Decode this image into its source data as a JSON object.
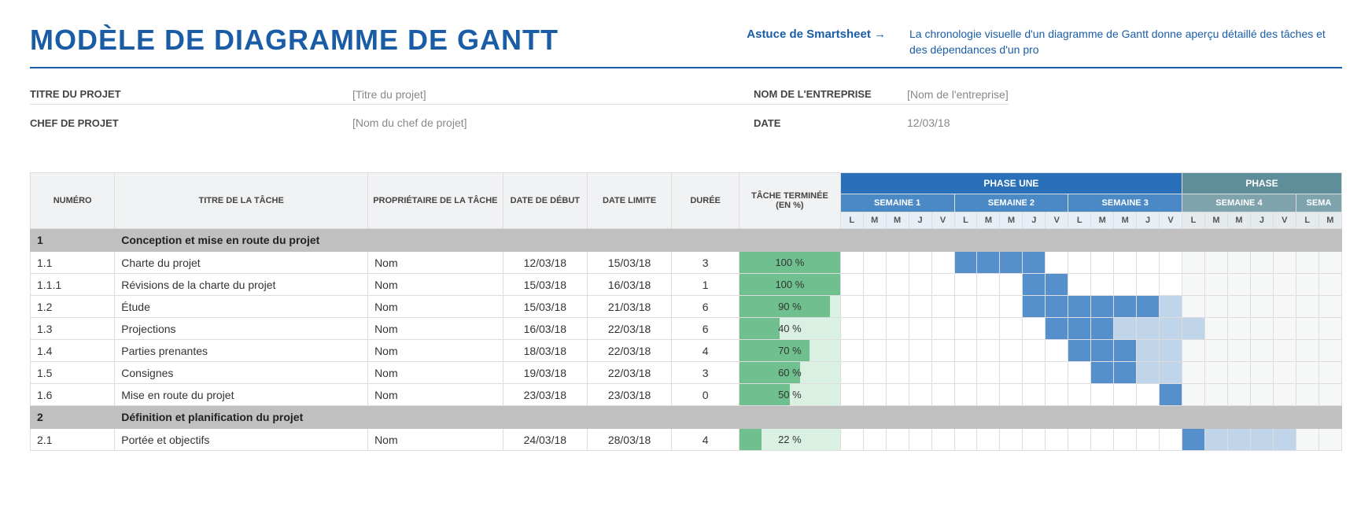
{
  "header": {
    "title": "MODÈLE DE DIAGRAMME DE GANTT",
    "tip_label": "Astuce de Smartsheet →",
    "tip_text": "La chronologie visuelle d'un diagramme de Gantt donne aperçu détaillé des tâches et des dépendances d'un pro"
  },
  "meta": {
    "project_title_label": "TITRE DU PROJET",
    "project_title_value": "[Titre du projet]",
    "project_manager_label": "CHEF DE PROJET",
    "project_manager_value": "[Nom du chef de projet]",
    "company_label": "NOM DE L'ENTREPRISE",
    "company_value": "[Nom de l'entreprise]",
    "date_label": "DATE",
    "date_value": "12/03/18"
  },
  "columns": {
    "num": "NUMÉRO",
    "title": "TITRE DE LA TÂCHE",
    "owner": "PROPRIÉTAIRE DE LA TÂCHE",
    "start": "DATE DE DÉBUT",
    "end": "DATE LIMITE",
    "duration": "DURÉE",
    "pct": "TÂCHE TERMINÉE (EN %)"
  },
  "phases": [
    {
      "label": "PHASE UNE",
      "weeks": [
        "SEMAINE 1",
        "SEMAINE 2",
        "SEMAINE 3"
      ]
    },
    {
      "label": "PHASE",
      "weeks": [
        "SEMAINE 4",
        "SEMA"
      ]
    }
  ],
  "days": [
    "L",
    "M",
    "M",
    "J",
    "V"
  ],
  "partial_days": [
    "L",
    "M"
  ],
  "rows": [
    {
      "type": "section",
      "num": "1",
      "title": "Conception et mise en route du projet"
    },
    {
      "type": "task",
      "num": "1.1",
      "title": "Charte du projet",
      "owner": "Nom",
      "start": "12/03/18",
      "end": "15/03/18",
      "duration": "3",
      "pct_label": "100 %",
      "pct": 100,
      "bar_start": 0,
      "bar_len": 0,
      "bar_dark_start": 5,
      "bar_dark_len": 4
    },
    {
      "type": "task",
      "num": "1.1.1",
      "title": "Révisions de la charte du projet",
      "owner": "Nom",
      "start": "15/03/18",
      "end": "16/03/18",
      "duration": "1",
      "pct_label": "100 %",
      "pct": 100,
      "bar_start": 0,
      "bar_len": 0,
      "bar_dark_start": 8,
      "bar_dark_len": 2
    },
    {
      "type": "task",
      "num": "1.2",
      "title": "Étude",
      "owner": "Nom",
      "start": "15/03/18",
      "end": "21/03/18",
      "duration": "6",
      "pct_label": "90 %",
      "pct": 90,
      "bar_start": 14,
      "bar_len": 1,
      "bar_dark_start": 8,
      "bar_dark_len": 6
    },
    {
      "type": "task",
      "num": "1.3",
      "title": "Projections",
      "owner": "Nom",
      "start": "16/03/18",
      "end": "22/03/18",
      "duration": "6",
      "pct_label": "40 %",
      "pct": 40,
      "bar_start": 12,
      "bar_len": 4,
      "bar_dark_start": 9,
      "bar_dark_len": 3
    },
    {
      "type": "task",
      "num": "1.4",
      "title": "Parties prenantes",
      "owner": "Nom",
      "start": "18/03/18",
      "end": "22/03/18",
      "duration": "4",
      "pct_label": "70 %",
      "pct": 70,
      "bar_start": 13,
      "bar_len": 2,
      "bar_dark_start": 10,
      "bar_dark_len": 3
    },
    {
      "type": "task",
      "num": "1.5",
      "title": "Consignes",
      "owner": "Nom",
      "start": "19/03/18",
      "end": "22/03/18",
      "duration": "3",
      "pct_label": "60 %",
      "pct": 60,
      "bar_start": 13,
      "bar_len": 2,
      "bar_dark_start": 11,
      "bar_dark_len": 2
    },
    {
      "type": "task",
      "num": "1.6",
      "title": "Mise en route du projet",
      "owner": "Nom",
      "start": "23/03/18",
      "end": "23/03/18",
      "duration": "0",
      "pct_label": "50 %",
      "pct": 50,
      "bar_start": 0,
      "bar_len": 0,
      "bar_dark_start": 14,
      "bar_dark_len": 1
    },
    {
      "type": "section",
      "num": "2",
      "title": "Définition et planification du projet"
    },
    {
      "type": "task",
      "num": "2.1",
      "title": "Portée et objectifs",
      "owner": "Nom",
      "start": "24/03/18",
      "end": "28/03/18",
      "duration": "4",
      "pct_label": "22 %",
      "pct": 22,
      "bar_start": 16,
      "bar_len": 4,
      "bar_dark_start": 15,
      "bar_dark_len": 1
    }
  ]
}
